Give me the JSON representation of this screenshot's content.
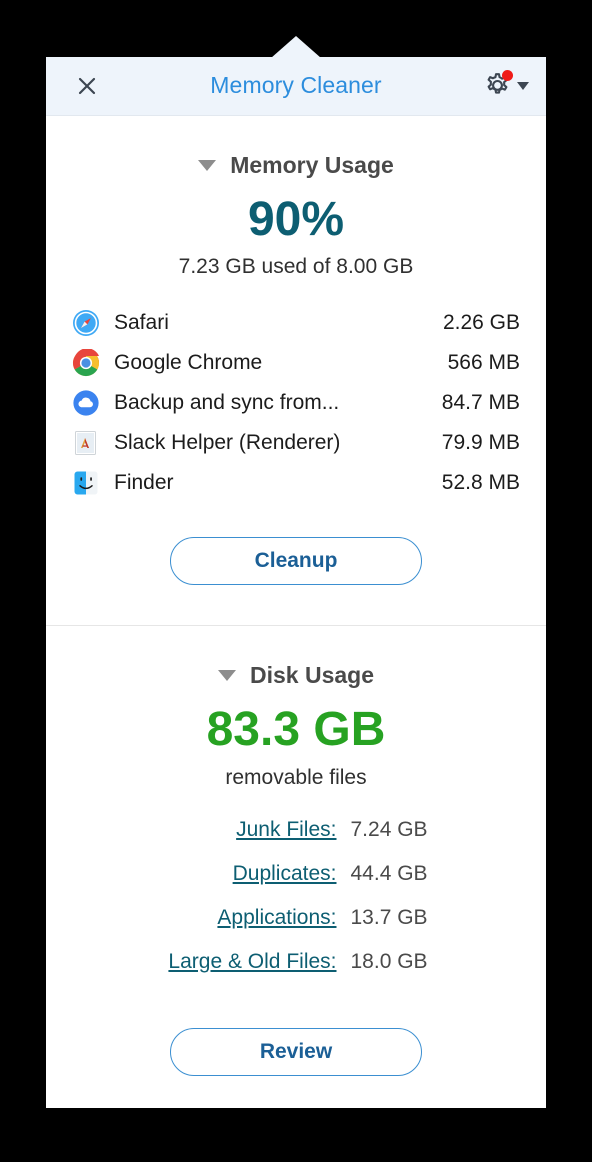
{
  "window": {
    "title": "Memory Cleaner",
    "close_icon": "close-icon",
    "settings_icon": "gear-icon",
    "settings_badge": "red-dot-badge",
    "settings_caret": "chevron-down-icon"
  },
  "memory": {
    "section_title": "Memory Usage",
    "collapse_icon": "triangle-down-icon",
    "percent": "90%",
    "detail": "7.23 GB used of 8.00 GB",
    "processes": [
      {
        "icon": "safari-icon",
        "name": "Safari",
        "size": "2.26 GB"
      },
      {
        "icon": "chrome-icon",
        "name": "Google Chrome",
        "size": "566 MB"
      },
      {
        "icon": "backup-and-sync-icon",
        "name": "Backup and sync from...",
        "size": "84.7 MB"
      },
      {
        "icon": "generic-app-icon",
        "name": "Slack Helper (Renderer)",
        "size": "79.9 MB"
      },
      {
        "icon": "finder-icon",
        "name": "Finder",
        "size": "52.8 MB"
      }
    ],
    "button_label": "Cleanup"
  },
  "disk": {
    "section_title": "Disk Usage",
    "collapse_icon": "triangle-down-icon",
    "amount": "83.3 GB",
    "caption": "removable files",
    "rows": [
      {
        "label": "Junk Files:",
        "value": "7.24 GB"
      },
      {
        "label": "Duplicates:",
        "value": "44.4 GB"
      },
      {
        "label": "Applications:",
        "value": "13.7 GB"
      },
      {
        "label": "Large & Old Files:",
        "value": "18.0 GB"
      }
    ],
    "button_label": "Review"
  },
  "colors": {
    "title_blue": "#2c8ddd",
    "memory_teal": "#0d5e72",
    "disk_green": "#27a222",
    "badge_red": "#ef1b18",
    "button_blue": "#1b5f96",
    "header_bg": "#eef4fb"
  }
}
